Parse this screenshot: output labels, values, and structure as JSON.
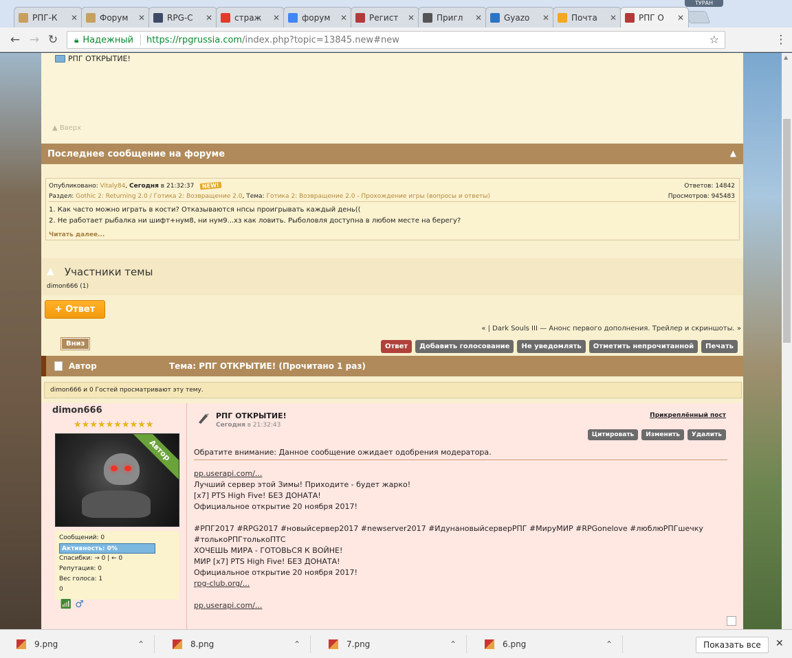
{
  "browser": {
    "tabs": [
      {
        "label": "РПГ-К",
        "color": "#c7a060"
      },
      {
        "label": "Форум",
        "color": "#c7a060"
      },
      {
        "label": "RPG-C",
        "color": "#3c4a66"
      },
      {
        "label": "страж",
        "color": "#e33a2c"
      },
      {
        "label": "форум",
        "color": "#4285f4"
      },
      {
        "label": "Регист",
        "color": "#b33a3a"
      },
      {
        "label": "Пригл",
        "color": "#555555"
      },
      {
        "label": "Gyazo",
        "color": "#2a74c8"
      },
      {
        "label": "Почта",
        "color": "#f5a623"
      },
      {
        "label": "РПГ О",
        "color": "#b33a3a"
      }
    ],
    "profile_label": "ТУРАН",
    "secure_label": "Надежный",
    "url_scheme_host": "https://rpgrussia.com",
    "url_path": "/index.php?topic=13845.new#new",
    "ext_badge": "2"
  },
  "forum": {
    "topic_link": "РПГ ОТКРЫТИЕ!",
    "back_up": "▲ Вверх",
    "last_post_header": "Последнее сообщение на форуме",
    "last_post": {
      "published_label": "Опубликовано:",
      "author": "Vitaly84",
      "today": "Сегодня",
      "time": "в 21:32:37",
      "new_badge": "NEW!",
      "replies": "Ответов: 14842",
      "section_label": "Раздел:",
      "section_link": "Gothic 2: Returning 2.0 / Готика 2: Возвращение 2.0",
      "topic_label": "Тема:",
      "topic_link": "Готика 2: Возвращение 2.0 - Прохождение игры (вопросы и ответы)",
      "views": "Просмотров: 945483",
      "line1": "1. Как часто можно играть в кости? Отказываются нпсы проигрывать каждый день((",
      "line2": "2. Не работает рыбалка ни шифт+нум8, ни нум9...хз как ловить. Рыболовля доступна в любом месте на берегу?",
      "read_more": "Читать далее..."
    },
    "participants_title": "Участники темы",
    "participants_list": "dimon666 (1)",
    "reply_button": "+ Ответ",
    "prevnext": "« | Dark Souls III — Анонс первого дополнения. Трейлер и скриншоты. »",
    "down_button": "Вниз",
    "actions": [
      "Ответ",
      "Добавить голосование",
      "Не уведомлять",
      "Отметить непрочитанной",
      "Печать"
    ],
    "thread_author": "Автор",
    "thread_topic": "Тема: РПГ ОТКРЫТИЕ!  (Прочитано 1 раз)",
    "viewers": "dimon666 и 0 Гостей просматривают эту тему."
  },
  "post": {
    "author": "dimon666",
    "stars": "★★★★★★★★★★",
    "ribbon": "Автор",
    "stats": {
      "messages": "Сообщений: 0",
      "activity": "Активность: 0%",
      "thanks": "Спасибки: → 0 | ← 0",
      "reputation": "Репутация: 0",
      "vote_weight": "Вес голоса: 1",
      "extra": "0"
    },
    "title": "РПГ ОТКРЫТИЕ!",
    "today": "Сегодня",
    "time": "в 21:32:43",
    "pinned": "Прикреплённый пост",
    "buttons": [
      "Цитировать",
      "Изменить",
      "Удалить"
    ],
    "moderation": "Обратите внимание: Данное сообщение ожидает одобрения модератора.",
    "lines": [
      "pp.userapi.com/...",
      "Лучший сервер этой Зимы! Приходите - будет жарко!",
      "[x7] PTS High Five! БЕЗ ДОНАТА!",
      "Официальное открытие 20 ноября 2017!",
      "",
      "#РПГ2017 #RPG2017 #новыйсервер2017 #newserver2017 #ИдунановыйсерверРПГ #МируМИР #RPGonelove #люблюРПГшечку",
      "#толькоРПГтолькоПТС",
      "ХОЧЕШЬ МИРА - ГОТОВЬСЯ К ВОЙНЕ!",
      "МИР [x7] PTS High Five! БЕЗ ДОНАТА!",
      "Официальное открытие 20 ноября 2017!",
      "rpg-club.org/...",
      "",
      "pp.userapi.com/..."
    ]
  },
  "downloads": {
    "items": [
      "9.png",
      "8.png",
      "7.png",
      "6.png"
    ],
    "show_all": "Показать все"
  }
}
